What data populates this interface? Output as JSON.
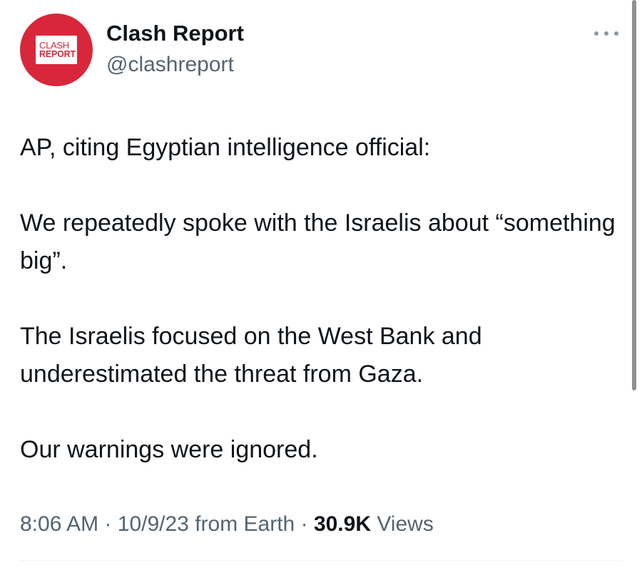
{
  "author": {
    "avatar_logo_top": "CLASH",
    "avatar_logo_bottom": "REPORT",
    "display_name": "Clash Report",
    "handle": "@clashreport"
  },
  "tweet": {
    "paragraphs": [
      "AP, citing Egyptian intelligence official:",
      "We repeatedly spoke with the Israelis about “something big”.",
      "The Israelis focused on the West Bank and underestimated the threat from Gaza.",
      "Our warnings were ignored."
    ]
  },
  "meta": {
    "time": "8:06 AM",
    "separator": "·",
    "date": "10/9/23",
    "source": "from Earth",
    "views_count": "30.9K",
    "views_label": "Views"
  },
  "icons": {
    "more": "more-horizontal-icon"
  },
  "colors": {
    "brand_red": "#d8273a",
    "text_primary": "#0f1419",
    "text_secondary": "#536471"
  }
}
